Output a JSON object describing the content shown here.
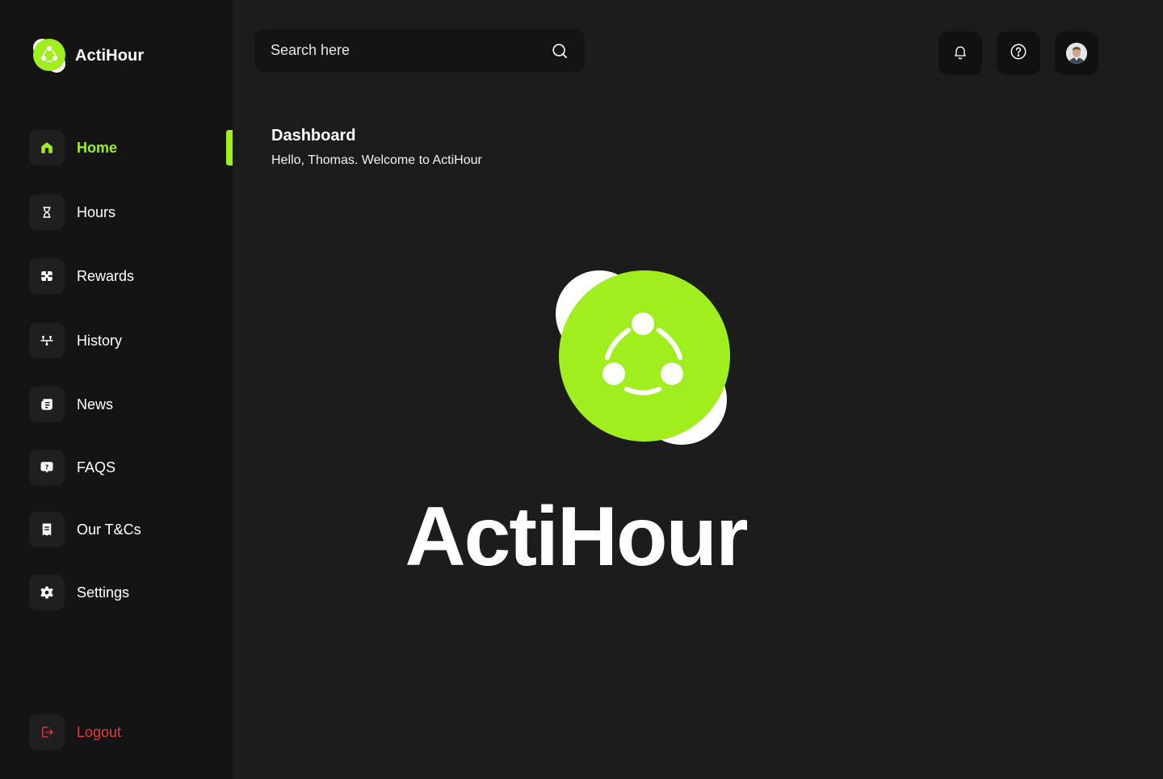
{
  "app": {
    "name": "ActiHour",
    "accent_color": "#a1ee1f",
    "danger_color": "#e8383d"
  },
  "sidebar": {
    "items": [
      {
        "label": "Home",
        "icon": "home-icon",
        "active": true
      },
      {
        "label": "Hours",
        "icon": "hourglass-icon",
        "active": false
      },
      {
        "label": "Rewards",
        "icon": "gift-box-icon",
        "active": false
      },
      {
        "label": "History",
        "icon": "timeline-icon",
        "active": false
      },
      {
        "label": "News",
        "icon": "news-icon",
        "active": false
      },
      {
        "label": "FAQS",
        "icon": "question-bubble-icon",
        "active": false
      },
      {
        "label": "Our T&Cs",
        "icon": "document-icon",
        "active": false
      },
      {
        "label": "Settings",
        "icon": "gear-icon",
        "active": false
      }
    ],
    "logout_label": "Logout"
  },
  "search": {
    "placeholder": "Search here"
  },
  "header": {
    "buttons": [
      "bell-icon",
      "help-icon",
      "avatar"
    ]
  },
  "main": {
    "title": "Dashboard",
    "subtitle": "Hello, Thomas. Welcome to ActiHour",
    "hero_name": "ActiHour"
  }
}
